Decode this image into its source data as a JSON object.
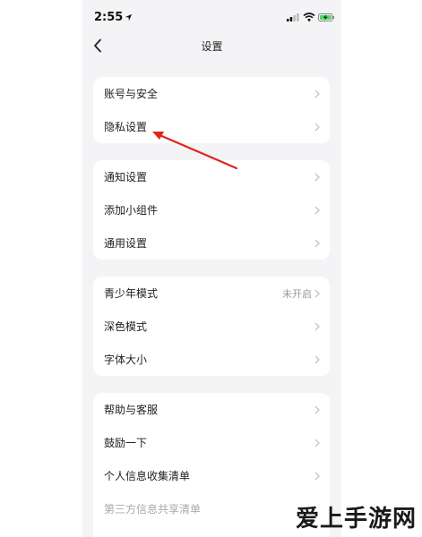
{
  "status_bar": {
    "time": "2:55",
    "icons": [
      "location-arrow-icon",
      "signal-icon",
      "wifi-icon",
      "battery-charging-icon"
    ]
  },
  "header": {
    "back_icon": "chevron-left-icon",
    "title": "设置"
  },
  "sections": [
    {
      "items": [
        {
          "label": "账号与安全",
          "value": ""
        },
        {
          "label": "隐私设置",
          "value": ""
        }
      ]
    },
    {
      "items": [
        {
          "label": "通知设置",
          "value": ""
        },
        {
          "label": "添加小组件",
          "value": ""
        },
        {
          "label": "通用设置",
          "value": ""
        }
      ]
    },
    {
      "items": [
        {
          "label": "青少年模式",
          "value": "未开启"
        },
        {
          "label": "深色模式",
          "value": ""
        },
        {
          "label": "字体大小",
          "value": ""
        }
      ]
    },
    {
      "items": [
        {
          "label": "帮助与客服",
          "value": ""
        },
        {
          "label": "鼓励一下",
          "value": ""
        },
        {
          "label": "个人信息收集清单",
          "value": ""
        },
        {
          "label": "第三方信息共享清单",
          "value": ""
        }
      ]
    }
  ],
  "annotation": {
    "arrow_color": "#e0241b"
  },
  "watermark": {
    "text": "爱上手游网"
  }
}
